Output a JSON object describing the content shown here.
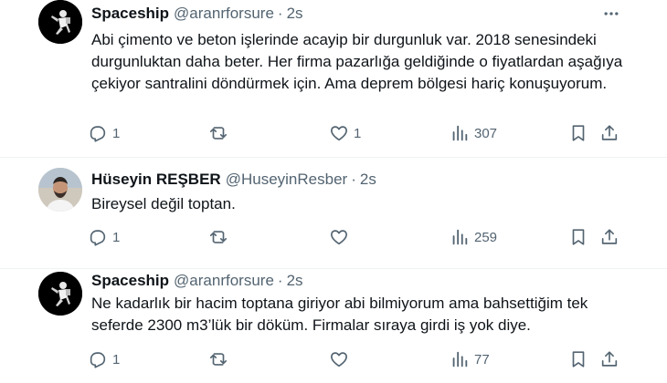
{
  "tweets": [
    {
      "name": "Spaceship",
      "handle": "@aranrforsure",
      "separator": "·",
      "time": "2s",
      "text": "Abi çimento ve beton işlerinde acayip bir durgunluk var. 2018 senesindeki durgunluktan daha beter. Her firma pazarlığa geldiğinde o fiyatlardan aşağıya çekiyor santralini döndürmek için. Ama deprem bölgesi hariç konuşuyorum.",
      "replies": "1",
      "retweets": "",
      "likes": "1",
      "views": "307"
    },
    {
      "name": "Hüseyin REŞBER",
      "handle": "@HuseyinResber",
      "separator": "·",
      "time": "2s",
      "text": "Bireysel değil toptan.",
      "replies": "1",
      "retweets": "",
      "likes": "",
      "views": "259"
    },
    {
      "name": "Spaceship",
      "handle": "@aranrforsure",
      "separator": "·",
      "time": "2s",
      "text": "Ne kadarlık bir hacim toptana giriyor abi bilmiyorum ama bahsettiğim tek seferde 2300 m3’lük bir döküm. Firmalar sıraya girdi iş yok diye.",
      "replies": "1",
      "retweets": "",
      "likes": "",
      "views": "77"
    }
  ],
  "icons": {
    "more": "more-horizontal-icon",
    "reply": "reply-icon",
    "retweet": "retweet-icon",
    "like": "heart-icon",
    "views": "views-icon",
    "bookmark": "bookmark-icon",
    "share": "share-icon"
  },
  "colors": {
    "text": "#0f1419",
    "muted": "#536471",
    "divider": "#eff3f4"
  }
}
